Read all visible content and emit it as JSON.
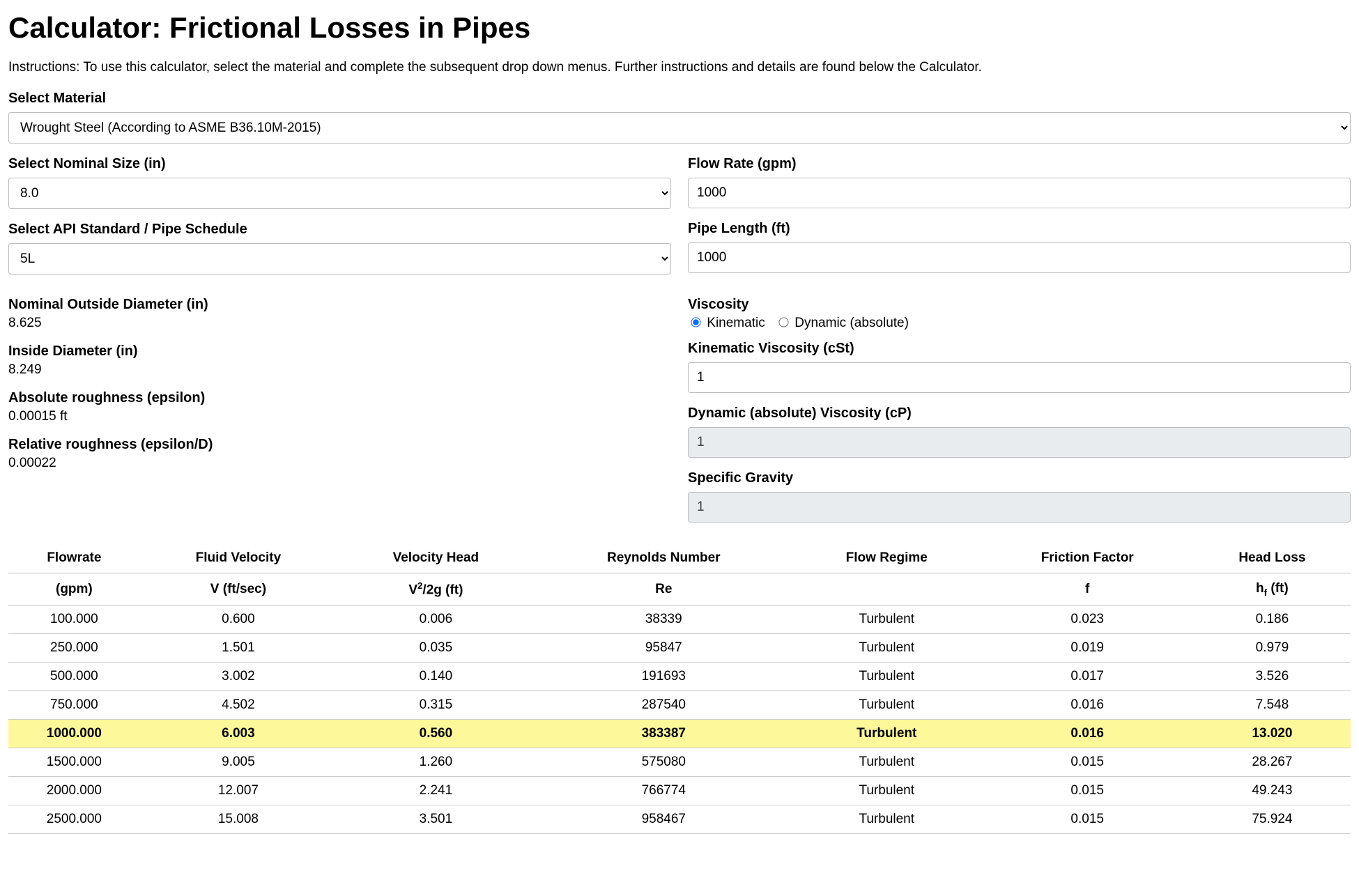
{
  "title": "Calculator: Frictional Losses in Pipes",
  "instructions": "Instructions: To use this calculator, select the material and complete the subsequent drop down menus. Further instructions and details are found below the Calculator.",
  "material": {
    "label": "Select Material",
    "value": "Wrought Steel (According to ASME B36.10M-2015)"
  },
  "nominal_size": {
    "label": "Select Nominal Size (in)",
    "value": "8.0"
  },
  "schedule": {
    "label": "Select API Standard / Pipe Schedule",
    "value": "5L"
  },
  "flow_rate": {
    "label": "Flow Rate (gpm)",
    "value": "1000"
  },
  "pipe_length": {
    "label": "Pipe Length (ft)",
    "value": "1000"
  },
  "nod": {
    "label": "Nominal Outside Diameter (in)",
    "value": "8.625"
  },
  "id": {
    "label": "Inside Diameter (in)",
    "value": "8.249"
  },
  "abs_rough": {
    "label": "Absolute roughness (epsilon)",
    "value": "0.00015 ft"
  },
  "rel_rough": {
    "label": "Relative roughness (epsilon/D)",
    "value": "0.00022"
  },
  "viscosity": {
    "label": "Viscosity",
    "opt_kinematic": "Kinematic",
    "opt_dynamic": "Dynamic (absolute)"
  },
  "kin_visc": {
    "label": "Kinematic Viscosity (cSt)",
    "value": "1"
  },
  "dyn_visc": {
    "label": "Dynamic (absolute) Viscosity (cP)",
    "value": "1"
  },
  "sg": {
    "label": "Specific Gravity",
    "value": "1"
  },
  "table": {
    "headers": {
      "flowrate": "Flowrate",
      "velocity": "Fluid Velocity",
      "vhead": "Velocity Head",
      "reynolds": "Reynolds Number",
      "regime": "Flow Regime",
      "ff": "Friction Factor",
      "hloss": "Head Loss"
    },
    "subheaders": {
      "flowrate": "(gpm)",
      "velocity": "V  (ft/sec)",
      "vhead_pre": "V",
      "vhead_mid": "/2g  (ft)",
      "reynolds": "Re",
      "regime": "",
      "ff": "f",
      "hloss_pre": "h",
      "hloss_post": " (ft)"
    },
    "rows": [
      {
        "flowrate": "100.000",
        "velocity": "0.600",
        "vhead": "0.006",
        "reynolds": "38339",
        "regime": "Turbulent",
        "ff": "0.023",
        "hloss": "0.186",
        "hl": false
      },
      {
        "flowrate": "250.000",
        "velocity": "1.501",
        "vhead": "0.035",
        "reynolds": "95847",
        "regime": "Turbulent",
        "ff": "0.019",
        "hloss": "0.979",
        "hl": false
      },
      {
        "flowrate": "500.000",
        "velocity": "3.002",
        "vhead": "0.140",
        "reynolds": "191693",
        "regime": "Turbulent",
        "ff": "0.017",
        "hloss": "3.526",
        "hl": false
      },
      {
        "flowrate": "750.000",
        "velocity": "4.502",
        "vhead": "0.315",
        "reynolds": "287540",
        "regime": "Turbulent",
        "ff": "0.016",
        "hloss": "7.548",
        "hl": false
      },
      {
        "flowrate": "1000.000",
        "velocity": "6.003",
        "vhead": "0.560",
        "reynolds": "383387",
        "regime": "Turbulent",
        "ff": "0.016",
        "hloss": "13.020",
        "hl": true
      },
      {
        "flowrate": "1500.000",
        "velocity": "9.005",
        "vhead": "1.260",
        "reynolds": "575080",
        "regime": "Turbulent",
        "ff": "0.015",
        "hloss": "28.267",
        "hl": false
      },
      {
        "flowrate": "2000.000",
        "velocity": "12.007",
        "vhead": "2.241",
        "reynolds": "766774",
        "regime": "Turbulent",
        "ff": "0.015",
        "hloss": "49.243",
        "hl": false
      },
      {
        "flowrate": "2500.000",
        "velocity": "15.008",
        "vhead": "3.501",
        "reynolds": "958467",
        "regime": "Turbulent",
        "ff": "0.015",
        "hloss": "75.924",
        "hl": false
      }
    ]
  }
}
